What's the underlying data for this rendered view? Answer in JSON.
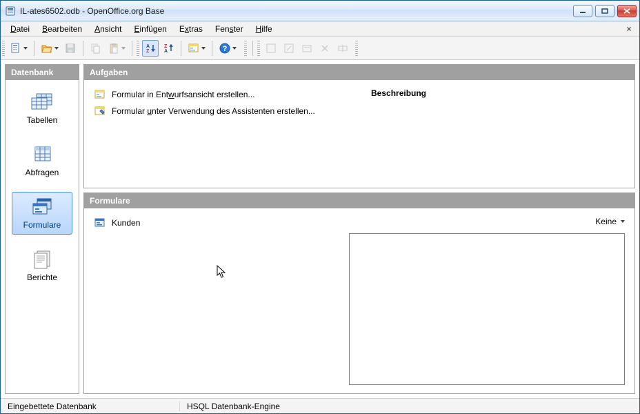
{
  "window": {
    "title": "IL-ates6502.odb - OpenOffice.org Base"
  },
  "menu": {
    "items": [
      {
        "pre": "",
        "ul": "D",
        "post": "atei"
      },
      {
        "pre": "",
        "ul": "B",
        "post": "earbeiten"
      },
      {
        "pre": "",
        "ul": "A",
        "post": "nsicht"
      },
      {
        "pre": "",
        "ul": "E",
        "post": "infügen"
      },
      {
        "pre": "E",
        "ul": "x",
        "post": "tras"
      },
      {
        "pre": "Fen",
        "ul": "s",
        "post": "ter"
      },
      {
        "pre": "",
        "ul": "H",
        "post": "ilfe"
      }
    ]
  },
  "sidebar": {
    "header": "Datenbank",
    "items": [
      {
        "label": "Tabellen"
      },
      {
        "label": "Abfragen"
      },
      {
        "label": "Formulare"
      },
      {
        "label": "Berichte"
      }
    ]
  },
  "tasks": {
    "header": "Aufgaben",
    "items": [
      {
        "pre": "Formular in Ent",
        "ul": "w",
        "post": "urfsansicht erstellen..."
      },
      {
        "pre": "Formular ",
        "ul": "u",
        "post": "nter Verwendung des Assistenten erstellen..."
      }
    ],
    "description_label": "Beschreibung"
  },
  "forms": {
    "header": "Formulare",
    "items": [
      {
        "label": "Kunden"
      }
    ],
    "view_label": "Keine"
  },
  "status": {
    "left": "Eingebettete Datenbank",
    "right": "HSQL Datenbank-Engine"
  }
}
